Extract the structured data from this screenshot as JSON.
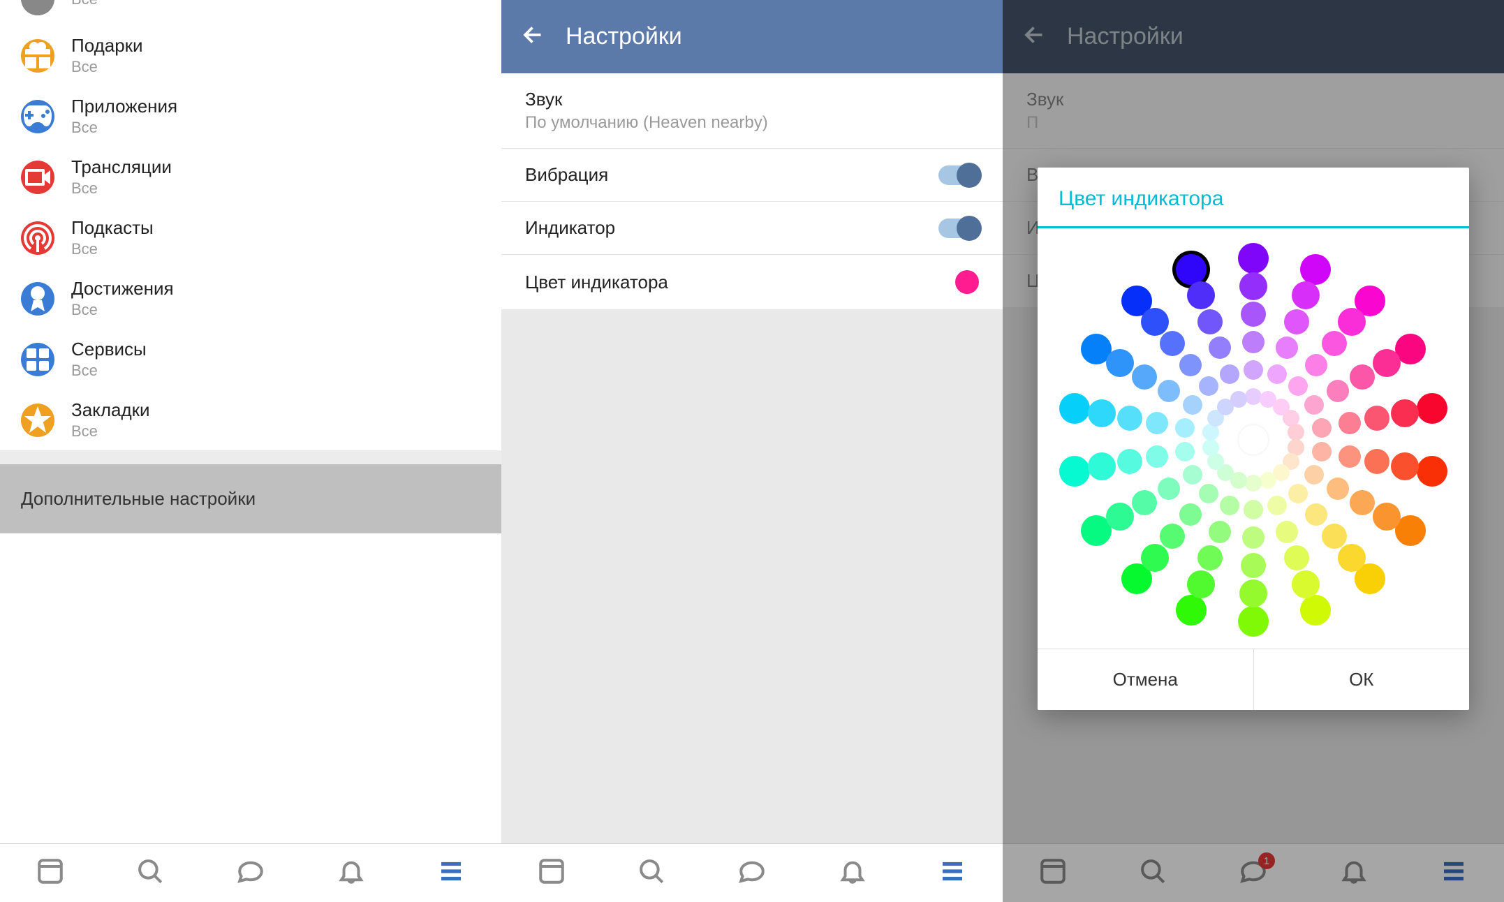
{
  "panel1": {
    "menu": [
      {
        "title": "",
        "sub": "Все",
        "icon_bg": "#555",
        "icon": "dark"
      },
      {
        "title": "Подарки",
        "sub": "Все",
        "icon_bg": "#f0a020",
        "icon": "gift"
      },
      {
        "title": "Приложения",
        "sub": "Все",
        "icon_bg": "#3a7bd5",
        "icon": "gamepad"
      },
      {
        "title": "Трансляции",
        "sub": "Все",
        "icon_bg": "#e53935",
        "icon": "camera"
      },
      {
        "title": "Подкасты",
        "sub": "Все",
        "icon_bg": "#e53935",
        "icon": "podcast"
      },
      {
        "title": "Достижения",
        "sub": "Все",
        "icon_bg": "#3a7bd5",
        "icon": "medal"
      },
      {
        "title": "Сервисы",
        "sub": "Все",
        "icon_bg": "#3a7bd5",
        "icon": "grid"
      },
      {
        "title": "Закладки",
        "sub": "Все",
        "icon_bg": "#f0a020",
        "icon": "star"
      }
    ],
    "extra_label": "Дополнительные настройки"
  },
  "settings": {
    "header": "Настройки",
    "sound_title": "Звук",
    "sound_sub": "По умолчанию (Heaven nearby)",
    "vibration": "Вибрация",
    "indicator": "Индикатор",
    "indicator_color_label": "Цвет индикатора",
    "indicator_color": "#ff1c90"
  },
  "dialog": {
    "title": "Цвет индикатора",
    "cancel": "Отмена",
    "ok": "ОК"
  },
  "nav": {
    "badge": "1"
  },
  "color_wheel": {
    "rings": [
      {
        "radius": 260,
        "size": 44,
        "light": 50
      },
      {
        "radius": 220,
        "size": 40,
        "light": 58
      },
      {
        "radius": 180,
        "size": 36,
        "light": 66
      },
      {
        "radius": 140,
        "size": 32,
        "light": 74
      },
      {
        "radius": 100,
        "size": 28,
        "light": 82
      },
      {
        "radius": 62,
        "size": 24,
        "light": 90
      }
    ],
    "count": 18,
    "center_size": 42,
    "selected": {
      "ring": 0,
      "index": 17
    }
  }
}
